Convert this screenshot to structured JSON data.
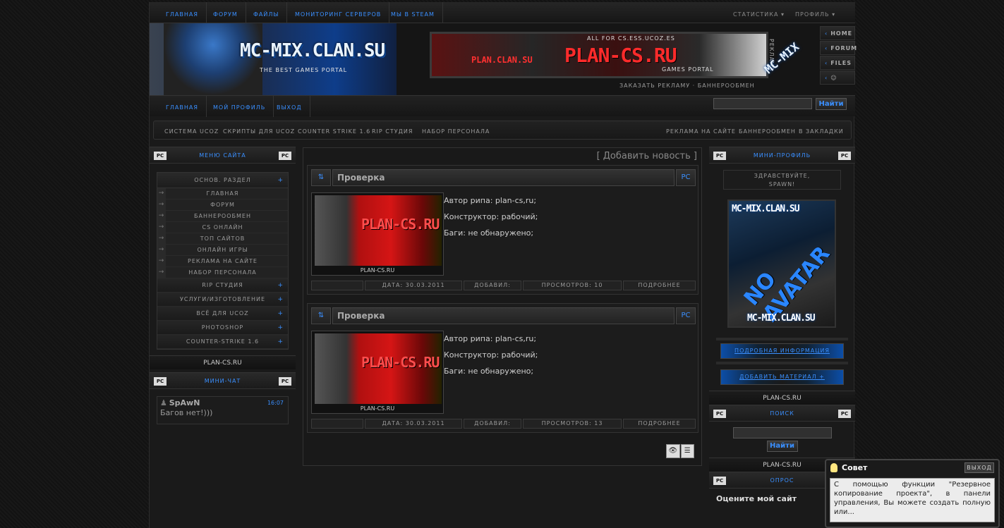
{
  "topnav": {
    "items": [
      "главная",
      "форум",
      "файлы",
      "мониторинг серверов",
      "мы в steam"
    ],
    "stats": "статистика",
    "profile": "профиль"
  },
  "header": {
    "logo_title": "MC-MIX.CLAN.SU",
    "logo_tagline": "THE BEST GAMES PORTAL",
    "banner_left": "PLAN.CLAN.SU",
    "banner_main": "PLAN-CS.RU",
    "banner_top": "ALL FOR CS.ESS.UCOZ.ES",
    "banner_sub": "GAMES PORTAL",
    "ad_tag": "РЕКЛАМА",
    "ad_links": "ЗАКАЗАТЬ РЕКЛАМУ · БАННЕРООБМЕН",
    "side_links": [
      "HOME",
      "FORUM",
      "FILES",
      "☺"
    ],
    "side_logo": "MC-MIX"
  },
  "nav2": {
    "items": [
      "главная",
      "мой профиль",
      "выход"
    ],
    "search_button": "Найти"
  },
  "nav3": {
    "left": [
      "система ucoz",
      "скрипты для ucoz",
      "counter strike 1.6",
      "rip студия",
      "набор персонала"
    ],
    "right": [
      "реклама на сайте",
      "баннерообмен",
      "в закладки"
    ]
  },
  "left": {
    "menu_title": "меню сайта",
    "pc": "PC",
    "section": "основ. раздел",
    "items": [
      "главная",
      "форум",
      "баннерообмен",
      "cs онлайн",
      "топ сайтов",
      "онлайн игры",
      "реклама на сайте",
      "набор персонала"
    ],
    "cats": [
      "rip студия",
      "услуги/изготовление",
      "всё для ucoz",
      "photoshop",
      "counter-strike 1.6"
    ],
    "footer": "PLAN-CS.RU",
    "chat_title": "мини-чат",
    "chat": {
      "user": "SpAwN",
      "time": "16:07",
      "message": "Багов нет!)))"
    }
  },
  "center": {
    "add_news": "[ Добавить новость ]",
    "posts": [
      {
        "title": "Проверка",
        "lines": [
          "Автор рипа: plan-cs,ru;",
          "Конструктор: рабочий;",
          "Баги: не обнаружено;"
        ],
        "img_text": "PLAN-CS.RU",
        "img_caption": "PLAN-CS.RU",
        "date": "Дата: 30.03.2011",
        "added": "Добавил:",
        "views": "Просмотров: 10",
        "more": "Подробнее"
      },
      {
        "title": "Проверка",
        "lines": [
          "Автор рипа: plan-cs,ru;",
          "Конструктор: рабочий;",
          "Баги: не обнаружено;"
        ],
        "img_text": "PLAN-CS.RU",
        "img_caption": "PLAN-CS.RU",
        "date": "Дата: 30.03.2011",
        "added": "Добавил:",
        "views": "Просмотров: 13",
        "more": "Подробнее"
      }
    ]
  },
  "right": {
    "profile_title": "мини-профиль",
    "greeting": "Здравствуйте,",
    "user": "SpAwN!",
    "avatar_top": "MC-MIX.CLAN.SU",
    "avatar_mid": "NO AVATAR",
    "avatar_bot": "MC-MIX.CLAN.SU",
    "btn_info": "Подробная информация",
    "btn_add": "Добавить материал +",
    "footer": "PLAN-CS.RU",
    "search_title": "поиск",
    "search_button": "Найти",
    "poll_title": "опрос",
    "poll_question": "Оцените мой сайт"
  },
  "tip": {
    "title": "Совет",
    "exit": "выход",
    "text": "С помощью функции \"Резервное копирование проекта\", в панели управления, Вы можете создать полную или..."
  }
}
